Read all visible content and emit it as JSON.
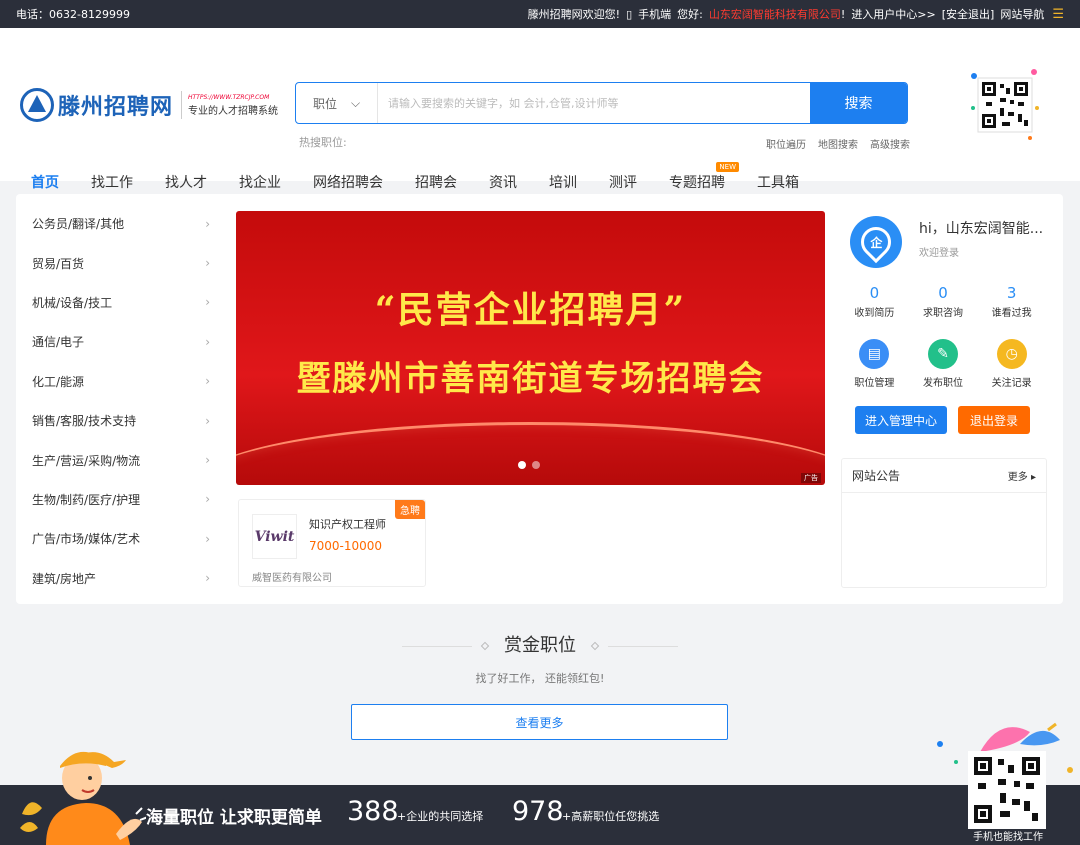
{
  "topbar": {
    "phone": "电话：0632-8129999",
    "welcome": "滕州招聘网欢迎您!",
    "mobile": "手机端",
    "hello": "您好:",
    "company": "山东宏阔智能科技有限公司",
    "exclaim": "!",
    "user_center": "进入用户中心>>",
    "logout": "[安全退出]",
    "site_nav": "网站导航",
    "menu_glyph": "☰",
    "phone_glyph": "▯"
  },
  "logo": {
    "name": "滕州招聘网",
    "url": "HTTPS://WWW.TZRCJP.COM",
    "slogan": "专业的人才招聘系统"
  },
  "search": {
    "type": "职位",
    "chevron": "⌵",
    "placeholder": "请输入要搜索的关键字，如 会计,仓管,设计师等",
    "button": "搜索",
    "hot_label": "热搜职位:",
    "links": [
      "职位遍历",
      "地图搜索",
      "高级搜索"
    ]
  },
  "nav": {
    "items": [
      "首页",
      "找工作",
      "找人才",
      "找企业",
      "网络招聘会",
      "招聘会",
      "资讯",
      "培训",
      "测评",
      "专题招聘",
      "工具箱"
    ],
    "new_badge": "NEW"
  },
  "categories": [
    "公务员/翻译/其他",
    "贸易/百货",
    "机械/设备/技工",
    "通信/电子",
    "化工/能源",
    "销售/客服/技术支持",
    "生产/营运/采购/物流",
    "生物/制药/医疗/护理",
    "广告/市场/媒体/艺术",
    "建筑/房地产"
  ],
  "chevron": "›",
  "banner": {
    "line1": "“民营企业招聘月”",
    "line2": "暨滕州市善南街道专场招聘会",
    "ad": "广告"
  },
  "job": {
    "urgent": "急聘",
    "logo_text": "Viwit",
    "title": "知识产权工程师",
    "salary": "7000-10000",
    "company": "威智医药有限公司"
  },
  "user": {
    "avatar_glyph": "企",
    "hi": "hi，山东宏阔智能...",
    "welcome": "欢迎登录",
    "stats": [
      {
        "num": "0",
        "label": "收到简历"
      },
      {
        "num": "0",
        "label": "求职咨询"
      },
      {
        "num": "3",
        "label": "谁看过我"
      }
    ],
    "actions": [
      {
        "label": "职位管理",
        "color": "#3a8ef6",
        "glyph": "▤"
      },
      {
        "label": "发布职位",
        "color": "#22c08a",
        "glyph": "✎"
      },
      {
        "label": "关注记录",
        "color": "#f5b820",
        "glyph": "◷"
      }
    ],
    "manage": "进入管理中心",
    "logout": "退出登录"
  },
  "notice": {
    "title": "网站公告",
    "more": "更多 ▸"
  },
  "reward": {
    "title": "赏金职位",
    "subtitle": "找了好工作， 还能领红包!",
    "more": "查看更多"
  },
  "footer": {
    "slogan": "海量职位 让求职更简单",
    "num1": "388",
    "text1": "+企业的共同选择",
    "num2": "978",
    "text2": "+高薪职位任您挑选",
    "qr_label": "手机也能找工作"
  }
}
